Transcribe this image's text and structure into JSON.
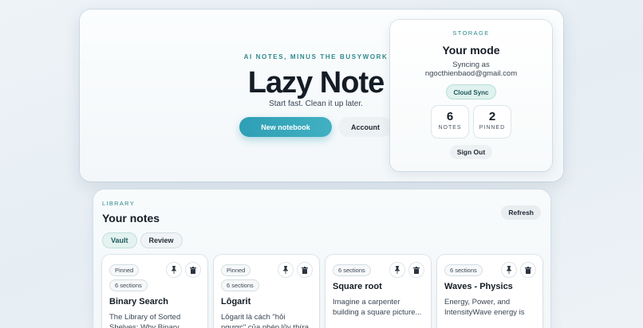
{
  "hero": {
    "eyebrow": "AI NOTES, MINUS THE BUSYWORK",
    "brand": "Lazy Note",
    "tagline": "Start fast. Clean it up later.",
    "new_notebook_label": "New notebook",
    "account_label": "Account"
  },
  "storage": {
    "eyebrow": "STORAGE",
    "title": "Your mode",
    "syncing_as": "Syncing as",
    "email": "ngocthienbaod@gmail.com",
    "mode_badge": "Cloud Sync",
    "stats": [
      {
        "value": "6",
        "label": "NOTES"
      },
      {
        "value": "2",
        "label": "PINNED"
      }
    ],
    "sign_out_label": "Sign Out"
  },
  "library": {
    "eyebrow": "LIBRARY",
    "title": "Your notes",
    "refresh_label": "Refresh",
    "tabs": [
      {
        "label": "Vault",
        "active": true
      },
      {
        "label": "Review",
        "active": false
      }
    ],
    "cards": [
      {
        "pinned": "Pinned",
        "sections": "6 sections",
        "title": "Binary Search",
        "excerpt": "The Library of Sorted Shelves: Why Binary Sear..."
      },
      {
        "pinned": "Pinned",
        "sections": "6 sections",
        "title": "Lôgarit",
        "excerpt": "Lôgarit là cách \"hỏi ngược\" của phép lũy thừa Nếu ta..."
      },
      {
        "pinned": "",
        "sections": "6 sections",
        "title": "Square root",
        "excerpt": "Imagine a carpenter building a square picture..."
      },
      {
        "pinned": "",
        "sections": "6 sections",
        "title": "Waves - Physics",
        "excerpt": "Energy, Power, and IntensityWave energy is th..."
      }
    ]
  },
  "icons": {
    "pin": "pin-icon",
    "delete": "trash-icon"
  },
  "colors": {
    "accent": "#2e9fb5",
    "eyebrow": "#2f8a8c",
    "badge_bg": "#dff2ef"
  }
}
